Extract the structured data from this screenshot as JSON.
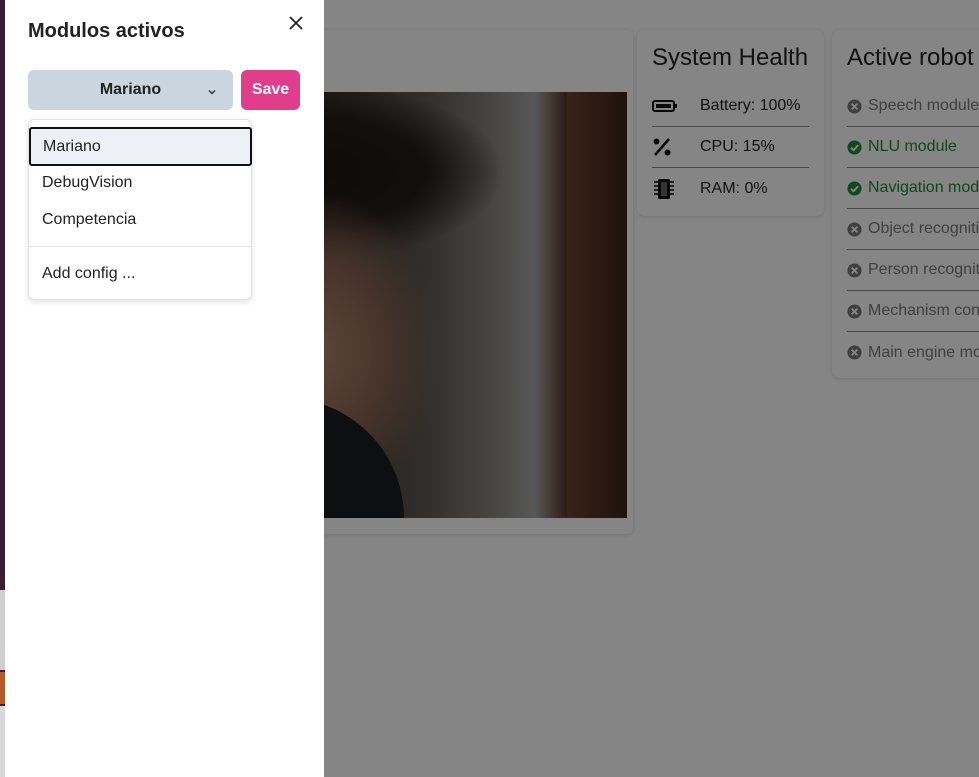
{
  "drawer": {
    "title": "Modulos activos",
    "selected_config": "Mariano",
    "save_label": "Save",
    "menu_items": [
      "Mariano",
      "DebugVision",
      "Competencia"
    ],
    "add_config_label": "Add config ..."
  },
  "system_health": {
    "title": "System Health",
    "items": [
      {
        "icon": "battery-icon",
        "label": "Battery: 100%"
      },
      {
        "icon": "percent-icon",
        "label": "CPU: 15%"
      },
      {
        "icon": "memory-chip-icon",
        "label": "RAM: 0%"
      }
    ]
  },
  "robot_modules": {
    "title": "Active robot",
    "items": [
      {
        "label": "Speech module",
        "status": "inactive"
      },
      {
        "label": "NLU module",
        "status": "active"
      },
      {
        "label": "Navigation mod",
        "status": "active"
      },
      {
        "label": "Object recogniti",
        "status": "inactive"
      },
      {
        "label": "Person recogniti",
        "status": "inactive"
      },
      {
        "label": "Mechanism con",
        "status": "inactive"
      },
      {
        "label": "Main engine mo",
        "status": "inactive"
      }
    ]
  },
  "colors": {
    "accent_pink": "#e03d8a",
    "select_bg": "#cbd5df",
    "status_active": "#1f8b34",
    "status_inactive": "#7a7a7a"
  }
}
